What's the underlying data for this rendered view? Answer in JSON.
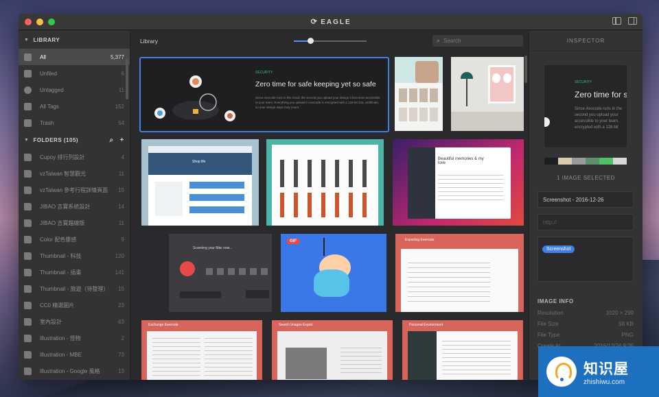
{
  "window": {
    "title": "EAGLE"
  },
  "sidebar": {
    "library_header": "LIBRARY",
    "library_items": [
      {
        "label": "All",
        "count": "5,377"
      },
      {
        "label": "Unfiled",
        "count": "6"
      },
      {
        "label": "Untagged",
        "count": "11"
      },
      {
        "label": "All Tags",
        "count": "152"
      },
      {
        "label": "Trash",
        "count": "54"
      }
    ],
    "folders_header": "FOLDERS (105)",
    "folders": [
      {
        "label": "Cupoy 排行列設計",
        "count": "4"
      },
      {
        "label": "vzTaiwan 智慧觀光",
        "count": "11"
      },
      {
        "label": "vzTaiwan 參考行程詳情頁面",
        "count": "15"
      },
      {
        "label": "JIBAO 吉寶系統設計",
        "count": "14"
      },
      {
        "label": "JIBAO 吉寶趨線版",
        "count": "11"
      },
      {
        "label": "Color 配色靈感",
        "count": "9"
      },
      {
        "label": "Thumbnail - 科技",
        "count": "120"
      },
      {
        "label": "Thumbnail - 插畫",
        "count": "141"
      },
      {
        "label": "Thumbnail - 旅遊（待整理）",
        "count": "15"
      },
      {
        "label": "CC0 精選圖片",
        "count": "23"
      },
      {
        "label": "室內設計",
        "count": "63"
      },
      {
        "label": "Illustration - 怪物",
        "count": "2"
      },
      {
        "label": "Illustration - MBE",
        "count": "73"
      },
      {
        "label": "Illustration - Google 風格",
        "count": "13"
      }
    ]
  },
  "toolbar": {
    "library_label": "Library",
    "search_placeholder": "Search"
  },
  "grid": {
    "featured": {
      "tag": "SECURITY",
      "heading": "Zero time for safe keeping yet so safe",
      "body": "Since Avocode runs in the cloud, the second you upload your design it becomes accessible to your team. Everything you upload in Avocode is encrypted with a 128-bit SSL certificate, so your design stays truly yours."
    },
    "gif_badge": "GIF",
    "card_titles": {
      "mobile_app": "Scanning your Mac now...",
      "memories": "Beautiful memories & my love",
      "shop": "Shop life",
      "exporter": "Exporting Evernote",
      "exchange": "Exchange Evernote",
      "search_images": "Search Images Export",
      "personal_environment": "Personal Environment"
    }
  },
  "inspector": {
    "header": "INSPECTOR",
    "preview_tag": "SECURITY",
    "preview_heading": "Zero time for sa",
    "preview_body": "Since Avocode runs in the second you upload your accessible to your team. encrypted with a 128-bit",
    "palette": [
      "#1e1e20",
      "#d8cbb0",
      "#9a9a9a",
      "#5f8f6b",
      "#4fbf6a",
      "#d7d7d7"
    ],
    "selected_text": "1 IMAGE SELECTED",
    "name_value": "Screenshot - 2016-12-26",
    "url_placeholder": "http://",
    "tag": "Screenshot",
    "info_title": "IMAGE INFO",
    "info": [
      {
        "key": "Resolution",
        "value": "1020 × 299"
      },
      {
        "key": "File Size",
        "value": "58 KB"
      },
      {
        "key": "File Type",
        "value": "PNG"
      },
      {
        "key": "Create At",
        "value": "2016/12/26 9:25"
      }
    ]
  },
  "watermark": {
    "brand": "知识屋",
    "url": "zhishiwu.com"
  },
  "colors": {
    "accent": "#3f7fe8",
    "sidebar": "#333335",
    "background": "#2a2a2c"
  }
}
